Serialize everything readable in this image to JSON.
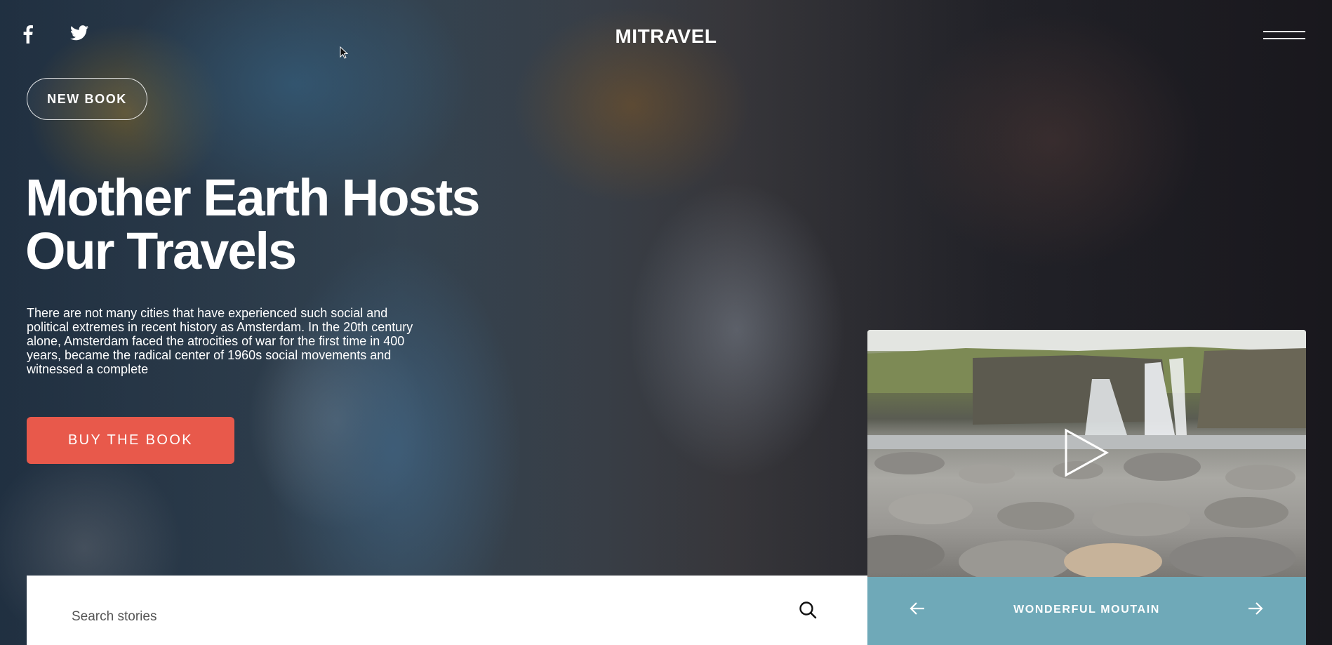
{
  "header": {
    "logo": "MITRAVEL",
    "social": [
      {
        "icon": "facebook-icon"
      },
      {
        "icon": "twitter-icon"
      }
    ],
    "menu_icon": "hamburger-menu-icon"
  },
  "hero": {
    "badge": "NEW BOOK",
    "title_line1": "Mother Earth Hosts",
    "title_line2": "Our Travels",
    "description": "There are not many cities that have experienced such social and political extremes in recent history as Amsterdam. In the 20th century alone, Amsterdam faced the atrocities of war for the first time in 400 years, became the radical center of 1960s social movements and witnessed a complete",
    "cta_label": "BUY THE BOOK"
  },
  "search": {
    "placeholder": "Search stories",
    "value": "",
    "icon": "search-icon"
  },
  "video_card": {
    "play_icon": "play-icon",
    "prev_icon": "arrow-left-icon",
    "next_icon": "arrow-right-icon",
    "caption": "WONDERFUL MOUTAIN"
  },
  "colors": {
    "cta": "#e8594b",
    "caption_bar": "#6fa9b8",
    "text": "#ffffff",
    "search_bg": "#ffffff"
  }
}
